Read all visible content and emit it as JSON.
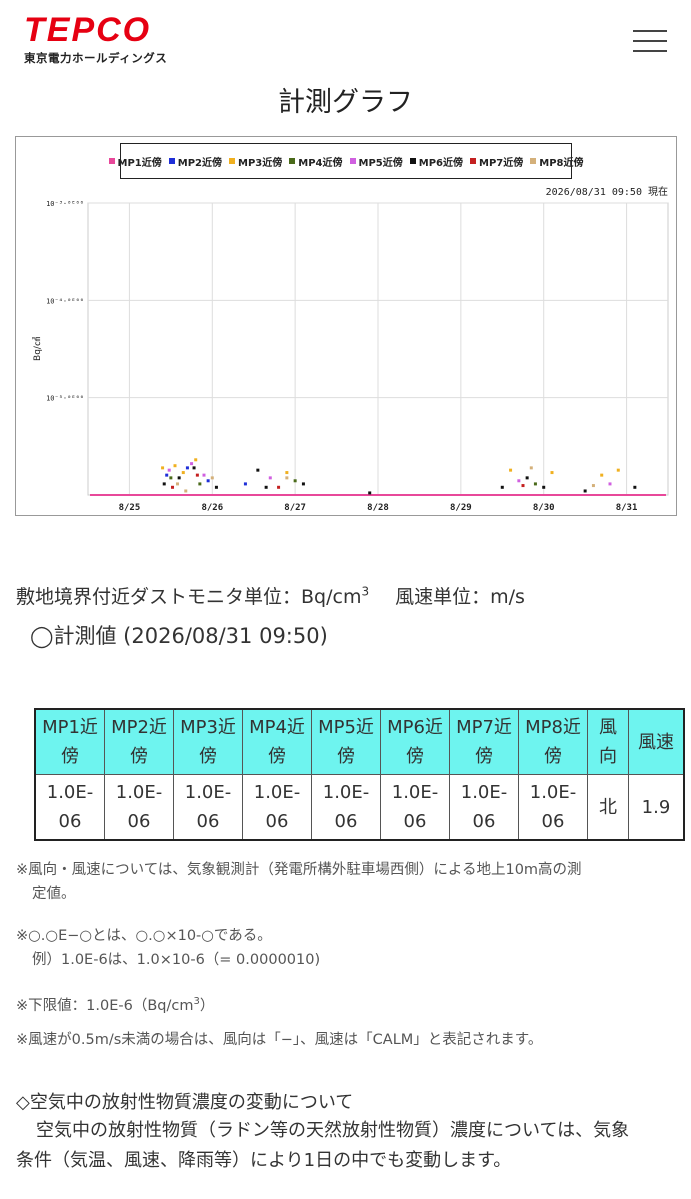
{
  "header": {
    "logo_main": "TEPCO",
    "logo_sub": "東京電力ホールディングス",
    "menu_icon": "hamburger-menu-icon"
  },
  "page_title": "計測グラフ",
  "chart_data": {
    "type": "scatter",
    "title": "",
    "timestamp": "2026/08/31 09:50 現在",
    "ylabel": "Bq/㎤",
    "y_scale": "log",
    "ylim": [
      1e-06,
      0.001
    ],
    "y_ticks": [
      {
        "value": 0.001,
        "label": "10⁻³·⁰ᴱ⁰⁰"
      },
      {
        "value": 0.0001,
        "label": "10⁻⁴·⁰ᴱ⁰⁰"
      },
      {
        "value": 1e-05,
        "label": "10⁻⁵·⁰ᴱ⁰⁰"
      }
    ],
    "x_ticks": [
      "8/25",
      "8/26",
      "8/27",
      "8/28",
      "8/29",
      "8/30",
      "8/31"
    ],
    "xlim": [
      0,
      7
    ],
    "grid": true,
    "legend_position": "top",
    "series": [
      {
        "name": "MP1近傍",
        "color": "#e8489a",
        "baseline": true,
        "points": [
          [
            0.2,
            1e-06
          ],
          [
            6.8,
            1e-06
          ]
        ]
      },
      {
        "name": "MP2近傍",
        "color": "#1f2fd8",
        "points": [
          [
            0.95,
            1.6e-06
          ],
          [
            1.2,
            1.9e-06
          ],
          [
            1.45,
            1.4e-06
          ],
          [
            1.9,
            1.3e-06
          ]
        ]
      },
      {
        "name": "MP3近傍",
        "color": "#f0b020",
        "points": [
          [
            0.9,
            1.9e-06
          ],
          [
            1.05,
            2e-06
          ],
          [
            1.15,
            1.7e-06
          ],
          [
            1.3,
            2.3e-06
          ],
          [
            2.4,
            1.7e-06
          ],
          [
            5.1,
            1.8e-06
          ],
          [
            5.6,
            1.7e-06
          ],
          [
            6.2,
            1.6e-06
          ],
          [
            6.4,
            1.8e-06
          ]
        ]
      },
      {
        "name": "MP4近傍",
        "color": "#4a6a1a",
        "points": [
          [
            1.0,
            1.5e-06
          ],
          [
            1.35,
            1.3e-06
          ],
          [
            2.5,
            1.4e-06
          ],
          [
            5.4,
            1.3e-06
          ]
        ]
      },
      {
        "name": "MP5近傍",
        "color": "#d060e0",
        "points": [
          [
            0.98,
            1.8e-06
          ],
          [
            1.25,
            2.1e-06
          ],
          [
            1.4,
            1.6e-06
          ],
          [
            2.2,
            1.5e-06
          ],
          [
            5.2,
            1.4e-06
          ],
          [
            6.3,
            1.3e-06
          ]
        ]
      },
      {
        "name": "MP6近傍",
        "color": "#111111",
        "points": [
          [
            0.92,
            1.3e-06
          ],
          [
            1.1,
            1.5e-06
          ],
          [
            1.28,
            1.9e-06
          ],
          [
            1.55,
            1.2e-06
          ],
          [
            2.05,
            1.8e-06
          ],
          [
            2.15,
            1.2e-06
          ],
          [
            2.6,
            1.3e-06
          ],
          [
            3.4,
            1.05e-06
          ],
          [
            5.0,
            1.2e-06
          ],
          [
            5.3,
            1.5e-06
          ],
          [
            5.5,
            1.2e-06
          ],
          [
            6.0,
            1.1e-06
          ],
          [
            6.6,
            1.2e-06
          ]
        ]
      },
      {
        "name": "MP7近傍",
        "color": "#c42020",
        "points": [
          [
            1.02,
            1.2e-06
          ],
          [
            1.32,
            1.6e-06
          ],
          [
            2.3,
            1.2e-06
          ],
          [
            5.25,
            1.25e-06
          ]
        ]
      },
      {
        "name": "MP8近傍",
        "color": "#d4b07a",
        "points": [
          [
            1.08,
            1.3e-06
          ],
          [
            1.18,
            1.1e-06
          ],
          [
            1.5,
            1.5e-06
          ],
          [
            2.4,
            1.5e-06
          ],
          [
            5.35,
            1.9e-06
          ],
          [
            6.1,
            1.25e-06
          ]
        ]
      }
    ]
  },
  "units_text": "敷地境界付近ダストモニタ単位：Bq/cm",
  "units_sup": "3",
  "units_wind": "風速単位：m/s",
  "measurement_label": "◯計測値 (2026/08/31 09:50)",
  "table": {
    "headers": [
      [
        "MP1近",
        "傍"
      ],
      [
        "MP2近",
        "傍"
      ],
      [
        "MP3近",
        "傍"
      ],
      [
        "MP4近",
        "傍"
      ],
      [
        "MP5近",
        "傍"
      ],
      [
        "MP6近",
        "傍"
      ],
      [
        "MP7近",
        "傍"
      ],
      [
        "MP8近",
        "傍"
      ],
      [
        "風",
        "向"
      ],
      [
        "風速"
      ]
    ],
    "values": [
      [
        "1.0E-",
        "06"
      ],
      [
        "1.0E-",
        "06"
      ],
      [
        "1.0E-",
        "06"
      ],
      [
        "1.0E-",
        "06"
      ],
      [
        "1.0E-",
        "06"
      ],
      [
        "1.0E-",
        "06"
      ],
      [
        "1.0E-",
        "06"
      ],
      [
        "1.0E-",
        "06"
      ],
      [
        "北"
      ],
      [
        "1.9"
      ]
    ]
  },
  "notes": {
    "n1_line1": "※風向・風速については、気象観測計（発電所構外駐車場西側）による地上10m高の測",
    "n1_line2": "定値。",
    "n2_line1": "※○.○E−○とは、○.○×10-○である。",
    "n2_line2": "例）1.0E-6は、1.0×10-6（= 0.0000010)",
    "n3_mark": "※",
    "n3_text": "下限値：1.0E-6（Bq/cm",
    "n3_sup": "3",
    "n3_end": "）",
    "n4": "※風速が0.5m/s未満の場合は、風向は「−」、風速は「CALM」と表記されます。"
  },
  "section_heading": "◇空気中の放射性物質濃度の変動について",
  "paragraph_line1": "空気中の放射性物質（ラドン等の天然放射性物質）濃度については、気象",
  "paragraph_line2": "条件（気温、風速、降雨等）により1日の中でも変動します。"
}
